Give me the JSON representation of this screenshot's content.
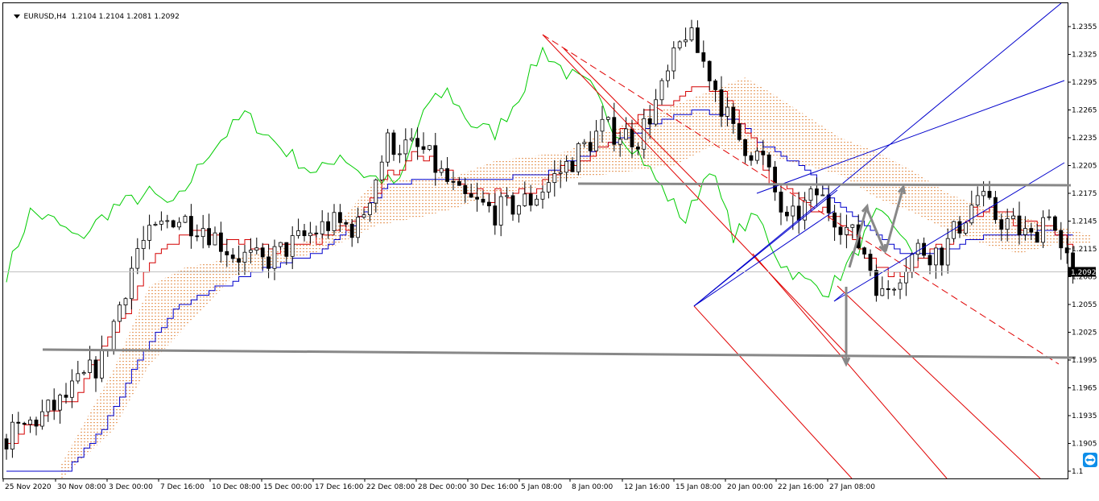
{
  "header": {
    "symbol": "EURUSD,H4",
    "ohlc": "1.2104 1.2104 1.2081 1.2092"
  },
  "icons": {
    "dropdown": "triangle-down-icon",
    "remote": "teamviewer-icon"
  },
  "colors": {
    "candle": "#000000",
    "tenkan": "#d40000",
    "kijun": "#0000cc",
    "chikou": "#00cc00",
    "cloud": "#e8a36b",
    "fork_red": "#e00000",
    "fork_blue": "#0000cc",
    "level": "#888888",
    "arrow": "#888888",
    "price_line": "#c0c0c0"
  },
  "chart_data": {
    "type": "candlestick",
    "symbol": "EURUSD",
    "timeframe": "H4",
    "current_price": "1.2092",
    "y_ticks": [
      "1.2355",
      "1.2325",
      "1.2295",
      "1.2265",
      "1.2235",
      "1.2205",
      "1.2175",
      "1.2145",
      "1.2115",
      "1.2085",
      "1.2055",
      "1.2025",
      "1.1995",
      "1.1965",
      "1.1935",
      "1.1905",
      "1.1"
    ],
    "ylim": [
      1.1862,
      1.2372
    ],
    "x_ticks": [
      "25 Nov 2020",
      "30 Nov 08:00",
      "3 Dec 00:00",
      "7 Dec 16:00",
      "10 Dec 08:00",
      "15 Dec 00:00",
      "17 Dec 16:00",
      "22 Dec 08:00",
      "28 Dec 00:00",
      "30 Dec 16:00",
      "5 Jan 08:00",
      "8 Jan 00:00",
      "12 Jan 16:00",
      "15 Jan 08:00",
      "20 Jan 00:00",
      "22 Jan 16:00",
      "27 Jan 08:00"
    ],
    "bars": 180,
    "price_path": [
      [
        0,
        1.191
      ],
      [
        9,
        1.1948
      ],
      [
        16,
        1.1995
      ],
      [
        22,
        1.2115
      ],
      [
        28,
        1.215
      ],
      [
        33,
        1.214
      ],
      [
        38,
        1.211
      ],
      [
        43,
        1.21
      ],
      [
        48,
        1.212
      ],
      [
        54,
        1.2142
      ],
      [
        59,
        1.2138
      ],
      [
        64,
        1.223
      ],
      [
        70,
        1.222
      ],
      [
        76,
        1.217
      ],
      [
        82,
        1.2155
      ],
      [
        88,
        1.2168
      ],
      [
        94,
        1.2205
      ],
      [
        100,
        1.2245
      ],
      [
        106,
        1.2235
      ],
      [
        110,
        1.2285
      ],
      [
        114,
        1.235
      ],
      [
        118,
        1.2305
      ],
      [
        122,
        1.224
      ],
      [
        127,
        1.221
      ],
      [
        131,
        1.214
      ],
      [
        136,
        1.2175
      ],
      [
        140,
        1.2145
      ],
      [
        144,
        1.2112
      ],
      [
        147,
        1.2063
      ],
      [
        150,
        1.2092
      ],
      [
        153,
        1.2115
      ],
      [
        157,
        1.211
      ],
      [
        160,
        1.2142
      ],
      [
        163,
        1.2172
      ],
      [
        166,
        1.215
      ],
      [
        169,
        1.214
      ],
      [
        172,
        1.2125
      ],
      [
        175,
        1.216
      ],
      [
        177,
        1.2108
      ],
      [
        179,
        1.2092
      ]
    ],
    "tenkan_path": [
      [
        0,
        1.1905
      ],
      [
        12,
        1.196
      ],
      [
        20,
        1.205
      ],
      [
        26,
        1.212
      ],
      [
        32,
        1.2135
      ],
      [
        40,
        1.212
      ],
      [
        48,
        1.2115
      ],
      [
        56,
        1.2135
      ],
      [
        62,
        1.218
      ],
      [
        68,
        1.222
      ],
      [
        74,
        1.2195
      ],
      [
        80,
        1.217
      ],
      [
        88,
        1.218
      ],
      [
        96,
        1.2212
      ],
      [
        104,
        1.2245
      ],
      [
        110,
        1.227
      ],
      [
        115,
        1.229
      ],
      [
        120,
        1.228
      ],
      [
        124,
        1.224
      ],
      [
        128,
        1.219
      ],
      [
        133,
        1.2165
      ],
      [
        138,
        1.2155
      ],
      [
        142,
        1.212
      ],
      [
        146,
        1.2095
      ],
      [
        150,
        1.2085
      ],
      [
        154,
        1.211
      ],
      [
        158,
        1.212
      ],
      [
        162,
        1.2155
      ],
      [
        166,
        1.216
      ],
      [
        170,
        1.214
      ],
      [
        174,
        1.2145
      ],
      [
        177,
        1.2128
      ],
      [
        179,
        1.2112
      ]
    ],
    "kijun_path": [
      [
        0,
        1.1875
      ],
      [
        10,
        1.1875
      ],
      [
        16,
        1.192
      ],
      [
        22,
        1.1995
      ],
      [
        28,
        1.205
      ],
      [
        34,
        1.207
      ],
      [
        40,
        1.2085
      ],
      [
        46,
        1.21
      ],
      [
        52,
        1.211
      ],
      [
        58,
        1.214
      ],
      [
        64,
        1.2185
      ],
      [
        72,
        1.219
      ],
      [
        80,
        1.219
      ],
      [
        90,
        1.2195
      ],
      [
        98,
        1.222
      ],
      [
        104,
        1.2235
      ],
      [
        110,
        1.2255
      ],
      [
        116,
        1.2265
      ],
      [
        122,
        1.2255
      ],
      [
        126,
        1.223
      ],
      [
        130,
        1.2215
      ],
      [
        134,
        1.22
      ],
      [
        138,
        1.217
      ],
      [
        142,
        1.215
      ],
      [
        146,
        1.213
      ],
      [
        150,
        1.2112
      ],
      [
        154,
        1.211
      ],
      [
        158,
        1.2115
      ],
      [
        162,
        1.2125
      ],
      [
        166,
        1.213
      ],
      [
        170,
        1.2128
      ],
      [
        174,
        1.2135
      ],
      [
        179,
        1.2128
      ]
    ],
    "chikou_path": [
      [
        0,
        1.2088
      ],
      [
        4,
        1.2155
      ],
      [
        8,
        1.2145
      ],
      [
        12,
        1.2125
      ],
      [
        18,
        1.216
      ],
      [
        24,
        1.2175
      ],
      [
        28,
        1.216
      ],
      [
        34,
        1.222
      ],
      [
        40,
        1.226
      ],
      [
        46,
        1.2225
      ],
      [
        52,
        1.2195
      ],
      [
        56,
        1.2218
      ],
      [
        60,
        1.2195
      ],
      [
        66,
        1.2185
      ],
      [
        70,
        1.2265
      ],
      [
        74,
        1.2285
      ],
      [
        78,
        1.225
      ],
      [
        82,
        1.224
      ],
      [
        86,
        1.228
      ],
      [
        90,
        1.233
      ],
      [
        94,
        1.2305
      ],
      [
        98,
        1.229
      ],
      [
        102,
        1.2245
      ],
      [
        106,
        1.222
      ],
      [
        110,
        1.218
      ],
      [
        114,
        1.2145
      ],
      [
        118,
        1.2205
      ],
      [
        122,
        1.213
      ],
      [
        126,
        1.215
      ],
      [
        130,
        1.21
      ],
      [
        134,
        1.208
      ],
      [
        138,
        1.207
      ],
      [
        142,
        1.2105
      ],
      [
        146,
        1.215
      ],
      [
        148,
        1.2145
      ],
      [
        150,
        1.2135
      ],
      [
        152,
        1.2105
      ]
    ],
    "cloud_path": [
      [
        9,
        1.1865,
        1.188
      ],
      [
        18,
        1.192,
        1.1985
      ],
      [
        24,
        1.199,
        1.2075
      ],
      [
        30,
        1.203,
        1.2095
      ],
      [
        38,
        1.2085,
        1.2105
      ],
      [
        46,
        1.21,
        1.2115
      ],
      [
        54,
        1.2115,
        1.213
      ],
      [
        62,
        1.214,
        1.219
      ],
      [
        70,
        1.215,
        1.219
      ],
      [
        76,
        1.216,
        1.2195
      ],
      [
        82,
        1.2175,
        1.221
      ],
      [
        88,
        1.218,
        1.2215
      ],
      [
        94,
        1.219,
        1.222
      ],
      [
        100,
        1.2195,
        1.224
      ],
      [
        106,
        1.22,
        1.2255
      ],
      [
        112,
        1.2205,
        1.227
      ],
      [
        118,
        1.2225,
        1.2285
      ],
      [
        124,
        1.222,
        1.23
      ],
      [
        128,
        1.2215,
        1.2285
      ],
      [
        134,
        1.2205,
        1.226
      ],
      [
        140,
        1.2195,
        1.2235
      ],
      [
        146,
        1.217,
        1.222
      ],
      [
        152,
        1.2155,
        1.22
      ],
      [
        158,
        1.2135,
        1.2175
      ],
      [
        164,
        1.212,
        1.216
      ],
      [
        170,
        1.211,
        1.215
      ],
      [
        176,
        1.212,
        1.214
      ],
      [
        182,
        1.212,
        1.213
      ]
    ]
  }
}
